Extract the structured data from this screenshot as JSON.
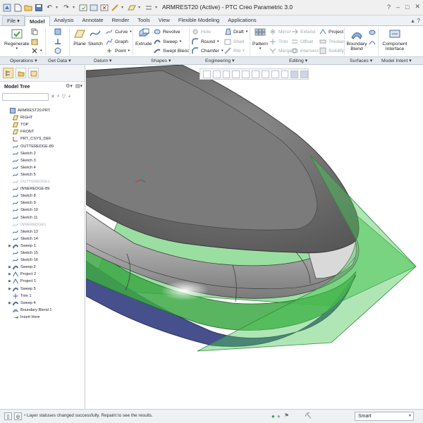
{
  "window": {
    "title": "ARMREST20 (Active) - PTC Creo Parametric 3.0",
    "controls": [
      "?",
      "–",
      "□",
      "✕"
    ]
  },
  "ribbon": {
    "tabs": [
      "File",
      "Model",
      "Analysis",
      "Annotate",
      "Render",
      "Tools",
      "View",
      "Flexible Modeling",
      "Applications"
    ],
    "active_tab": "Model",
    "buttons": {
      "regenerate": "Regenerate",
      "plane": "Plane",
      "sketch": "Sketch",
      "curve": "Curve",
      "graph": "Graph",
      "point": "Point",
      "extrude": "Extrude",
      "revolve": "Revolve",
      "sweep": "Sweep",
      "swept_blend": "Swept Blend",
      "hole": "Hole",
      "round": "Round",
      "chamfer": "Chamfer",
      "draft": "Draft",
      "shell": "Shell",
      "rib": "Rib",
      "pattern": "Pattern",
      "mirror": "Mirror",
      "trim": "Trim",
      "merge": "Merge",
      "extend": "Extend",
      "offset": "Offset",
      "intersect": "Intersect",
      "project": "Project",
      "thicken": "Thicken",
      "solidify": "Solidify",
      "boundary_blend": "Boundary Blend",
      "component_interface": "Component Interface"
    },
    "groups": [
      "Operations",
      "Get Data",
      "Datum",
      "Shapes",
      "Engineering",
      "Editing",
      "Surfaces",
      "Model Intent"
    ]
  },
  "model_tree": {
    "title": "Model Tree",
    "items": [
      {
        "label": "ARMREST20.PRT",
        "icon": "part-icon",
        "expandable": false,
        "suppressed": false
      },
      {
        "label": "RIGHT",
        "icon": "datum-plane-icon",
        "expandable": false,
        "suppressed": false
      },
      {
        "label": "TOP",
        "icon": "datum-plane-icon",
        "expandable": false,
        "suppressed": false
      },
      {
        "label": "FRONT",
        "icon": "datum-plane-icon",
        "expandable": false,
        "suppressed": false
      },
      {
        "label": "PRT_CSYS_DEF",
        "icon": "csys-icon",
        "expandable": false,
        "suppressed": false
      },
      {
        "label": "OUTTEREDGE-89",
        "icon": "sketch-icon",
        "expandable": false,
        "suppressed": false
      },
      {
        "label": "Sketch 2",
        "icon": "sketch-icon",
        "expandable": false,
        "suppressed": false
      },
      {
        "label": "Sketch 3",
        "icon": "sketch-icon",
        "expandable": false,
        "suppressed": false
      },
      {
        "label": "Sketch 4",
        "icon": "sketch-icon",
        "expandable": false,
        "suppressed": false
      },
      {
        "label": "Sketch 5",
        "icon": "sketch-icon",
        "expandable": false,
        "suppressed": false
      },
      {
        "label": "OUTTEREDGE1",
        "icon": "sketch-icon",
        "expandable": false,
        "suppressed": true
      },
      {
        "label": "INNEREDGE-89",
        "icon": "sketch-icon",
        "expandable": false,
        "suppressed": false
      },
      {
        "label": "Sketch 8",
        "icon": "sketch-icon",
        "expandable": false,
        "suppressed": false
      },
      {
        "label": "Sketch 9",
        "icon": "sketch-icon",
        "expandable": false,
        "suppressed": false
      },
      {
        "label": "Sketch 10",
        "icon": "sketch-icon",
        "expandable": false,
        "suppressed": false
      },
      {
        "label": "Sketch 11",
        "icon": "sketch-icon",
        "expandable": false,
        "suppressed": false
      },
      {
        "label": "INNEREDGE1",
        "icon": "sketch-icon",
        "expandable": false,
        "suppressed": true
      },
      {
        "label": "Sketch 13",
        "icon": "sketch-icon",
        "expandable": false,
        "suppressed": false
      },
      {
        "label": "Sketch 14",
        "icon": "sketch-icon",
        "expandable": false,
        "suppressed": false
      },
      {
        "label": "Sweep 1",
        "icon": "sweep-icon",
        "expandable": true,
        "suppressed": false
      },
      {
        "label": "Sketch 15",
        "icon": "sketch-icon",
        "expandable": false,
        "suppressed": false
      },
      {
        "label": "Sketch 16",
        "icon": "sketch-icon",
        "expandable": false,
        "suppressed": false
      },
      {
        "label": "Sweep 2",
        "icon": "sweep-icon",
        "expandable": true,
        "suppressed": false
      },
      {
        "label": "Project 2",
        "icon": "project-icon",
        "expandable": true,
        "suppressed": false
      },
      {
        "label": "Project 1",
        "icon": "project-icon",
        "expandable": true,
        "suppressed": false
      },
      {
        "label": "Sweep 5",
        "icon": "sweep-icon",
        "expandable": true,
        "suppressed": false
      },
      {
        "label": "Trim 1",
        "icon": "trim-icon",
        "expandable": false,
        "suppressed": false
      },
      {
        "label": "Sweep 4",
        "icon": "sweep-icon",
        "expandable": true,
        "suppressed": false
      },
      {
        "label": "Boundary Blend 1",
        "icon": "boundary-blend-icon",
        "expandable": false,
        "suppressed": false
      },
      {
        "label": "Insert Here",
        "icon": "insert-here-icon",
        "expandable": false,
        "suppressed": false
      }
    ]
  },
  "status": {
    "message": "Layer statuses changed successfully. Repaint to see the results.",
    "filter": "Smart"
  },
  "colors": {
    "surface_green": "#4fc75a",
    "body_gray": "#6e6e6e",
    "edge_blue": "#4a4e8a",
    "ribbon_bg": "#eef1f5"
  }
}
